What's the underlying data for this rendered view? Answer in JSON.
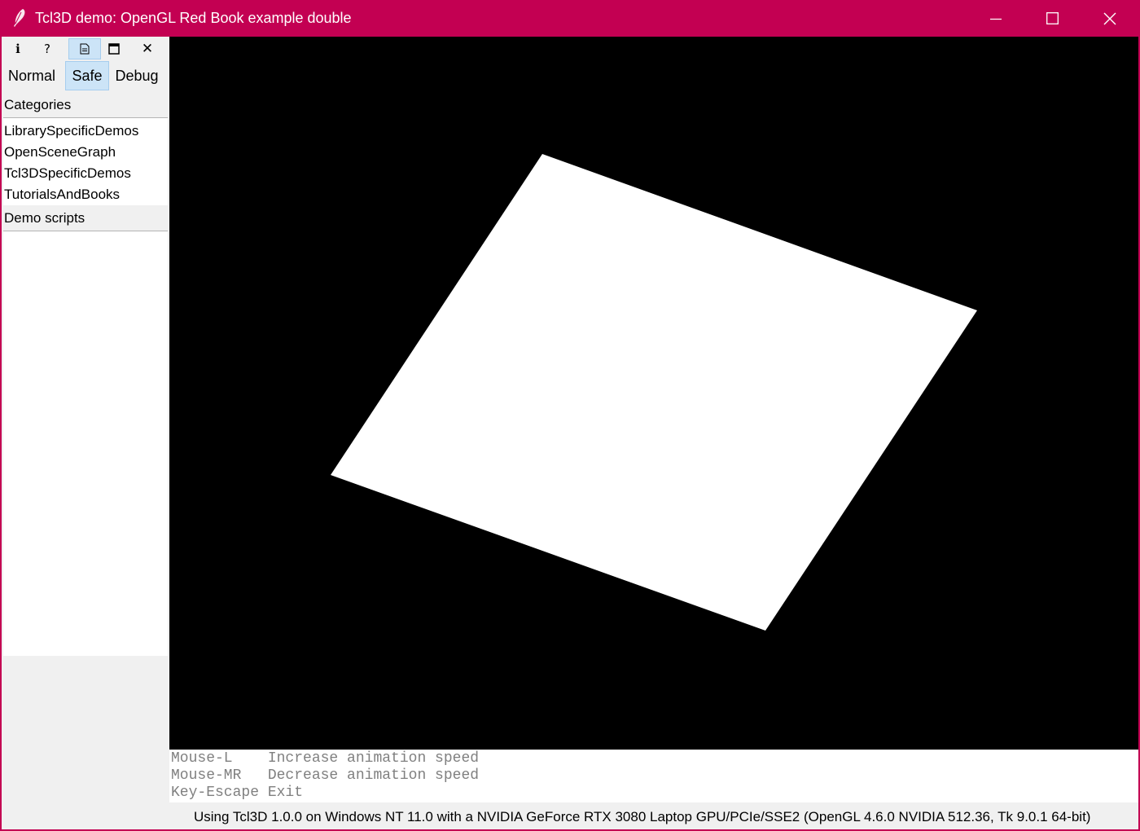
{
  "window": {
    "title": "Tcl3D demo: OpenGL Red Book example double",
    "accent_color": "#c30052",
    "controls": [
      "minimize-icon",
      "maximize-icon",
      "close-icon"
    ]
  },
  "toolbar": {
    "buttons": [
      {
        "icon": "info-icon",
        "glyph": "i"
      },
      {
        "icon": "help-icon",
        "glyph": "?"
      },
      {
        "icon": "document-icon",
        "glyph": "",
        "active": true
      },
      {
        "icon": "window-icon",
        "glyph": ""
      },
      {
        "icon": "close-icon",
        "glyph": "✕"
      }
    ],
    "modes": [
      {
        "label": "Normal",
        "active": false
      },
      {
        "label": "Safe",
        "active": true
      },
      {
        "label": "Debug",
        "active": false
      }
    ]
  },
  "categories": {
    "label": "Categories",
    "items": [
      "LibrarySpecificDemos",
      "OpenSceneGraph",
      "Tcl3DSpecificDemos",
      "TutorialsAndBooks"
    ]
  },
  "demo_scripts": {
    "label": "Demo scripts",
    "items": []
  },
  "canvas": {
    "background": "#000000",
    "shape_color": "#ffffff",
    "shape": "rotating-square"
  },
  "help": {
    "lines": [
      "Mouse-L    Increase animation speed",
      "Mouse-MR   Decrease animation speed",
      "Key-Escape Exit"
    ]
  },
  "status": {
    "text": "Using Tcl3D 1.0.0 on Windows NT 11.0 with a NVIDIA GeForce RTX 3080 Laptop GPU/PCIe/SSE2 (OpenGL 4.6.0 NVIDIA 512.36, Tk 9.0.1 64-bit)"
  }
}
